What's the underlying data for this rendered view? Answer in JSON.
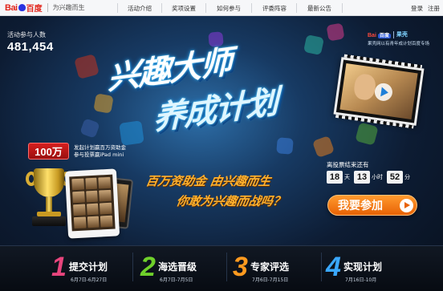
{
  "header": {
    "logo_text_bai": "Bai",
    "logo_text_du": "百度",
    "slogan": "为兴趣而生",
    "nav": [
      "活动介绍",
      "奖项设置",
      "如何参与",
      "评委阵容",
      "最新公告"
    ],
    "login": "登录",
    "register": "注册"
  },
  "stats": {
    "label": "活动参与人数",
    "count": "481,454"
  },
  "partner": {
    "baidu": "Bai",
    "du_badge": "百度",
    "brand2": "果壳",
    "caption": "果壳网以有青年成计划百度专场"
  },
  "hero": {
    "title_line1": "兴趣大师",
    "title_line2": "养成计划",
    "prize_badge": "100万",
    "prize_desc_line1": "发起计划赢百万资助金",
    "prize_desc_line2": "参与投票赢iPad mini",
    "slogan_line1": "百万资助金 由兴趣而生",
    "slogan_line2": "你敢为兴趣而战吗？"
  },
  "countdown": {
    "label": "离投票结束还有",
    "days": "18",
    "days_unit": "天",
    "hours": "13",
    "hours_unit": "小时",
    "minutes": "52",
    "minutes_unit": "分"
  },
  "cta": {
    "join_label": "我要参加"
  },
  "steps": [
    {
      "num": "1",
      "title": "提交计划",
      "dates": "6月7日-6月27日",
      "color": "#e8457d"
    },
    {
      "num": "2",
      "title": "海选晋级",
      "dates": "6月7日-7月5日",
      "color": "#6fd02b"
    },
    {
      "num": "3",
      "title": "专家评选",
      "dates": "7月6日-7月15日",
      "color": "#ff9a1f"
    },
    {
      "num": "4",
      "title": "实现计划",
      "dates": "7月16日-10月",
      "color": "#3aa8ff"
    }
  ]
}
